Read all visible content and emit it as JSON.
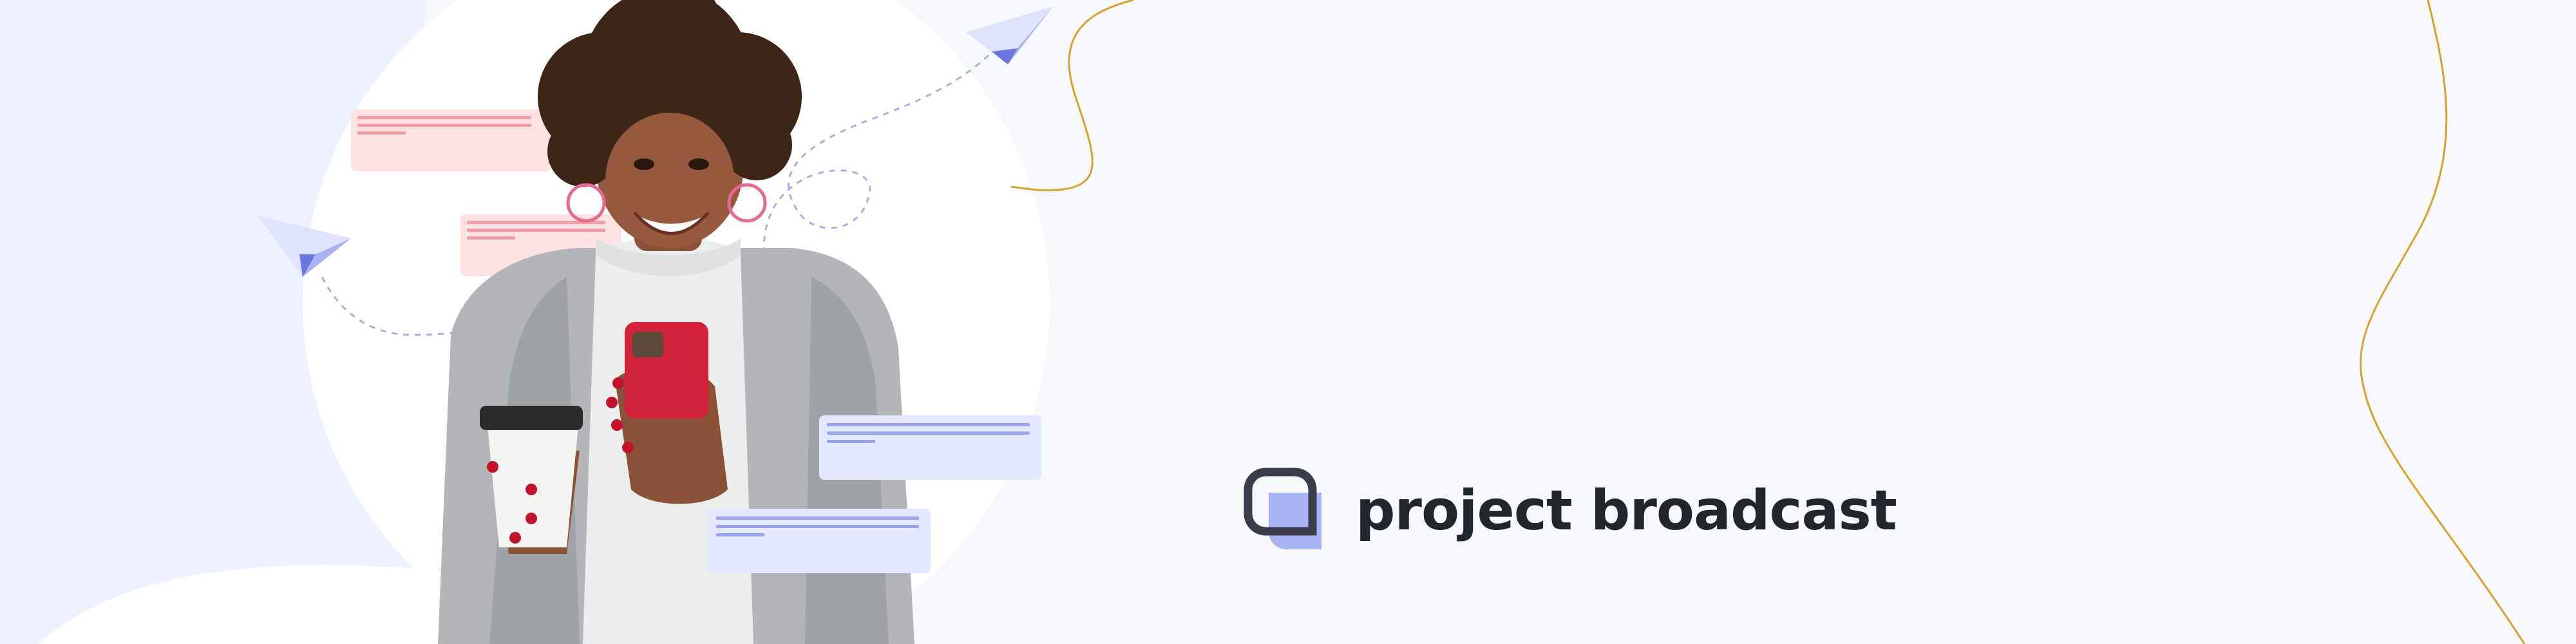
{
  "brand": {
    "name": "project broadcast",
    "logo_icon": "chat-bubble-logo-icon",
    "text_color": "#23252d",
    "accent_color": "#a9b1f5"
  },
  "illustration": {
    "subject": "person-holding-phone-and-coffee",
    "decor_icons": [
      "paper-plane-icon",
      "paper-plane-icon"
    ],
    "message_bubbles": {
      "pink": [
        "#fde1e3",
        "#f19ca4"
      ],
      "lavender": [
        "#e3e7ff",
        "#99a3f2"
      ]
    },
    "curve_color": "#d9a12e"
  },
  "colors": {
    "background": "#f6f8fb",
    "panel": "#eef1ff",
    "circle": "#ffffff"
  }
}
